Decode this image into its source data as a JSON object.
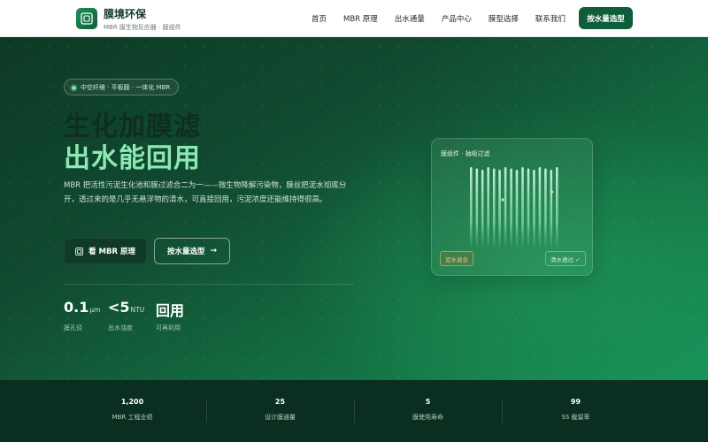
{
  "brand": {
    "name": "膜境环保",
    "tagline": "MBR 膜生物反应器 · 膜组件"
  },
  "nav": {
    "items": [
      "首页",
      "MBR 原理",
      "出水通量",
      "产品中心",
      "膜型选择",
      "联系我们"
    ],
    "cta": "按水量选型"
  },
  "hero": {
    "pill": "中空纤维 · 平板膜 · 一体化 MBR",
    "title_line1": "生化加膜滤",
    "title_line2": "出水能回用",
    "description": "MBR 把活性污泥生化池和膜过滤合二为一——微生物降解污染物，膜丝把泥水彻底分开，透过来的是几乎无悬浮物的清水，可直接回用，污泥浓度还能维持得很高。",
    "primary_button": "看 MBR 原理",
    "secondary_button": "按水量选型",
    "secondary_arrow": "→",
    "stats": [
      {
        "value": "0.1",
        "unit": "μm",
        "label": "膜孔径"
      },
      {
        "value": "<5",
        "unit": "NTU",
        "label": "出水浊度"
      },
      {
        "value": "回用",
        "unit": "",
        "label": "可再利用"
      }
    ]
  },
  "membrane_card": {
    "title": "膜组件 · 抽吸过滤",
    "sludge_tag": "泥水混合",
    "clear_tag": "清水透过 ✓",
    "fiber_count": 16,
    "colors": {
      "fiber": "#a8f0c8",
      "sludge": "#f3c47c"
    }
  },
  "bottom_stats": [
    {
      "value": "1,200",
      "label": "MBR 工程业绩"
    },
    {
      "value": "25",
      "label": "设计膜通量"
    },
    {
      "value": "5",
      "label": "膜使用寿命"
    },
    {
      "value": "99",
      "label": "SS 截留率"
    }
  ],
  "colors": {
    "brand_dark": "#0f5d3b",
    "accent_green": "#8be9b5",
    "band_bg": "#0a2e1f"
  }
}
